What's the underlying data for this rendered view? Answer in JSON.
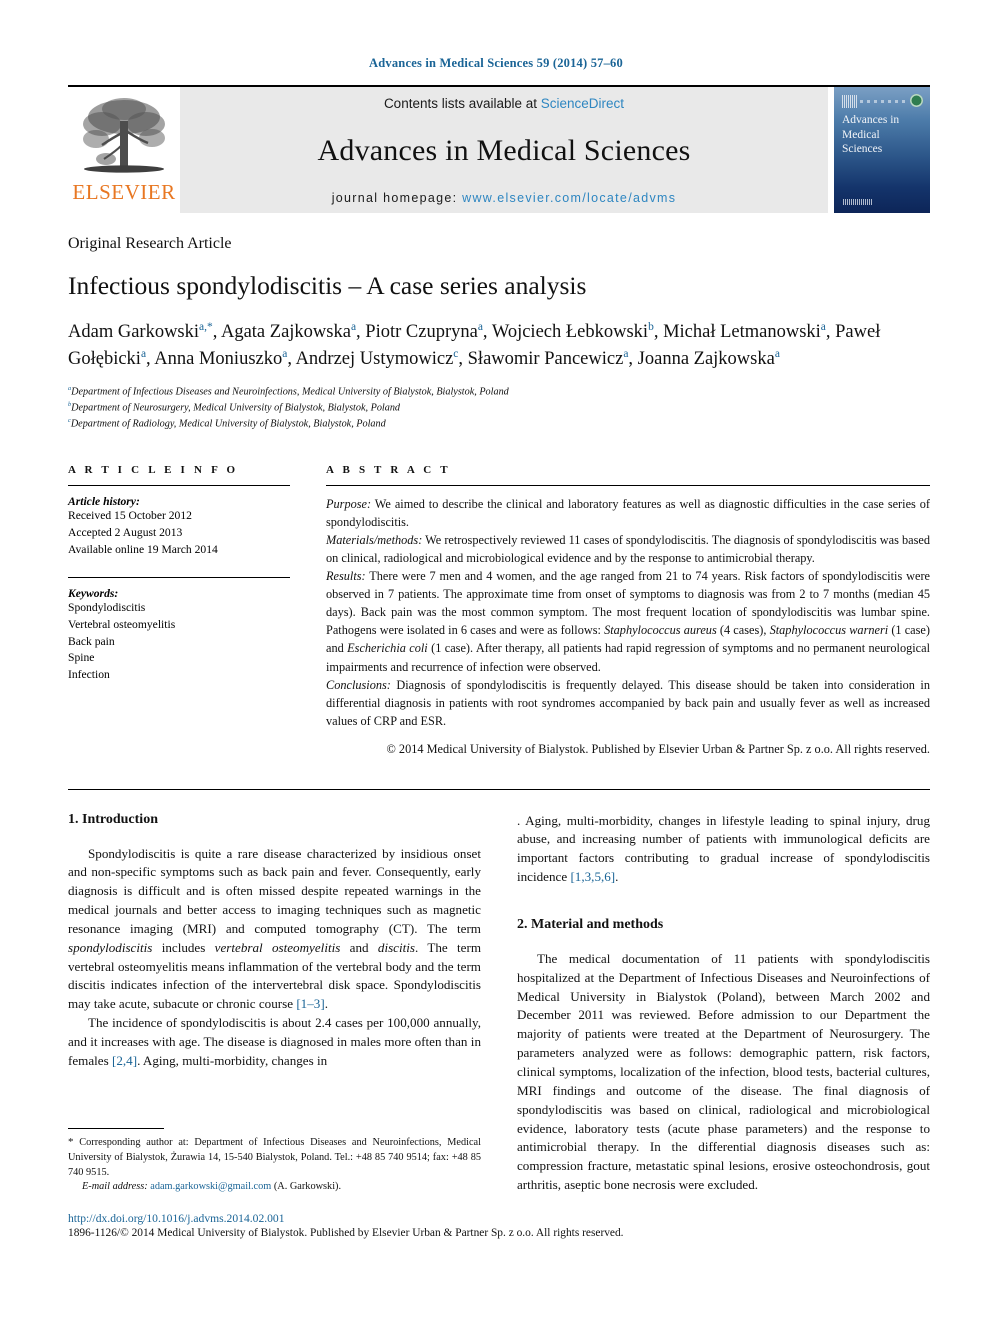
{
  "running_head": "Advances in Medical Sciences 59 (2014) 57–60",
  "masthead": {
    "elsevier_wordmark": "ELSEVIER",
    "contents_prefix": "Contents lists available at ",
    "sciencedirect": "ScienceDirect",
    "journal_title": "Advances in Medical Sciences",
    "homepage_prefix": "journal homepage: ",
    "homepage_url": "www.elsevier.com/locate/advms",
    "cover_title": "Advances in Medical Sciences",
    "link_color": "#2e86c1",
    "elsevier_orange": "#E87722"
  },
  "title_block": {
    "article_type": "Original Research Article",
    "title": "Infectious spondylodiscitis – A case series analysis",
    "authors_line1": "Adam Garkowski",
    "authors": [
      {
        "name": "Adam Garkowski",
        "sup": "a,*"
      },
      {
        "name": "Agata Zajkowska",
        "sup": "a"
      },
      {
        "name": "Piotr Czupryna",
        "sup": "a"
      },
      {
        "name": "Wojciech Łebkowski",
        "sup": "b"
      },
      {
        "name": "Michał Letmanowski",
        "sup": "a"
      },
      {
        "name": "Paweł Gołębicki",
        "sup": "a"
      },
      {
        "name": "Anna Moniuszko",
        "sup": "a"
      },
      {
        "name": "Andrzej Ustymowicz",
        "sup": "c"
      },
      {
        "name": "Sławomir Pancewicz",
        "sup": "a"
      },
      {
        "name": "Joanna Zajkowska",
        "sup": "a"
      }
    ],
    "affiliations": [
      {
        "mark": "a",
        "text": "Department of Infectious Diseases and Neuroinfections, Medical University of Bialystok, Bialystok, Poland"
      },
      {
        "mark": "b",
        "text": "Department of Neurosurgery, Medical University of Bialystok, Bialystok, Poland"
      },
      {
        "mark": "c",
        "text": "Department of Radiology, Medical University of Bialystok, Bialystok, Poland"
      }
    ]
  },
  "article_info": {
    "label": "A R T I C L E   I N F O",
    "history_head": "Article history:",
    "received": "Received 15 October 2012",
    "accepted": "Accepted 2 August 2013",
    "available": "Available online 19 March 2014",
    "keywords_head": "Keywords:",
    "keywords": [
      "Spondylodiscitis",
      "Vertebral osteomyelitis",
      "Back pain",
      "Spine",
      "Infection"
    ]
  },
  "abstract": {
    "label": "A B S T R A C T",
    "purpose_head": "Purpose:",
    "purpose_text": " We aimed to describe the clinical and laboratory features as well as diagnostic difficulties in the case series of spondylodiscitis.",
    "methods_head": "Materials/methods:",
    "methods_text": " We retrospectively reviewed 11 cases of spondylodiscitis. The diagnosis of spondylodiscitis was based on clinical, radiological and microbiological evidence and by the response to antimicrobial therapy.",
    "results_head": "Results:",
    "results_text_1": " There were 7 men and 4 women, and the age ranged from 21 to 74 years. Risk factors of spondylodiscitis were observed in 7 patients. The approximate time from onset of symptoms to diagnosis was from 2 to 7 months (median 45 days). Back pain was the most common symptom. The most frequent location of spondylodiscitis was lumbar spine. Pathogens were isolated in 6 cases and were as follows: ",
    "pathogen_1": "Staphylococcus aureus",
    "results_text_2": " (4 cases), ",
    "pathogen_2": "Staphylococcus warneri",
    "results_text_3": " (1 case) and ",
    "pathogen_3": "Escherichia coli",
    "results_text_4": " (1 case). After therapy, all patients had rapid regression of symptoms and no permanent neurological impairments and recurrence of infection were observed.",
    "conclusions_head": "Conclusions:",
    "conclusions_text": " Diagnosis of spondylodiscitis is frequently delayed. This disease should be taken into consideration in differential diagnosis in patients with root syndromes accompanied by back pain and usually fever as well as increased values of CRP and ESR.",
    "copyright": "© 2014 Medical University of Bialystok. Published by Elsevier Urban & Partner Sp. z o.o. All rights reserved."
  },
  "body": {
    "intro_heading": "1. Introduction",
    "intro_p1_a": "Spondylodiscitis is quite a rare disease characterized by insidious onset and non-specific symptoms such as back pain and fever. Consequently, early diagnosis is difficult and is often missed despite repeated warnings in the medical journals and better access to imaging techniques such as magnetic resonance imaging (MRI) and computed tomography (CT). The term ",
    "intro_p1_ital1": "spondylodiscitis",
    "intro_p1_b": " includes ",
    "intro_p1_ital2": "vertebral osteomyelitis",
    "intro_p1_c": " and ",
    "intro_p1_ital3": "discitis",
    "intro_p1_d": ". The term vertebral osteomyelitis means inflammation of the vertebral body and the term discitis indicates infection of the intervertebral disk space. Spondylodiscitis may take acute, subacute or chronic course ",
    "intro_p1_ref": "[1–3]",
    "intro_p1_end": ".",
    "intro_p2_a": "The incidence of spondylodiscitis is about 2.4 cases per 100,000 annually, and it increases with age. The disease is diagnosed in males more often than in females ",
    "intro_p2_ref1": "[2,4]",
    "intro_p2_b": ". Aging, multi-morbidity, changes in lifestyle leading to spinal injury, drug abuse, and increasing number of patients with immunological deficits are important factors contributing to gradual increase of spondylodiscitis incidence ",
    "intro_p2_ref2": "[1,3,5,6]",
    "intro_p2_end": ".",
    "methods_heading": "2. Material and methods",
    "methods_p1": "The medical documentation of 11 patients with spondylodiscitis hospitalized at the Department of Infectious Diseases and Neuroinfections of Medical University in Bialystok (Poland), between March 2002 and December 2011 was reviewed. Before admission to our Department the majority of patients were treated at the Department of Neurosurgery. The parameters analyzed were as follows: demographic pattern, risk factors, clinical symptoms, localization of the infection, blood tests, bacterial cultures, MRI findings and outcome of the disease. The final diagnosis of spondylodiscitis was based on clinical, radiological and microbiological evidence, laboratory tests (acute phase parameters) and the response to antimicrobial therapy. In the differential diagnosis diseases such as: compression fracture, metastatic spinal lesions, erosive osteochondrosis, gout arthritis, aseptic bone necrosis were excluded."
  },
  "footnotes": {
    "corresponding": "Corresponding author at: Department of Infectious Diseases and Neuroinfections, Medical University of Bialystok, Żurawia 14, 15-540 Bialystok, Poland. Tel.: +48 85 740 9514; fax: +48 85 740 9515.",
    "email_label": "E-mail address:",
    "email": "adam.garkowski@gmail.com",
    "email_owner": "(A. Garkowski)."
  },
  "page_footer": {
    "doi": "http://dx.doi.org/10.1016/j.advms.2014.02.001",
    "issn_line": "1896-1126/© 2014 Medical University of Bialystok. Published by Elsevier Urban & Partner Sp. z o.o. All rights reserved."
  }
}
